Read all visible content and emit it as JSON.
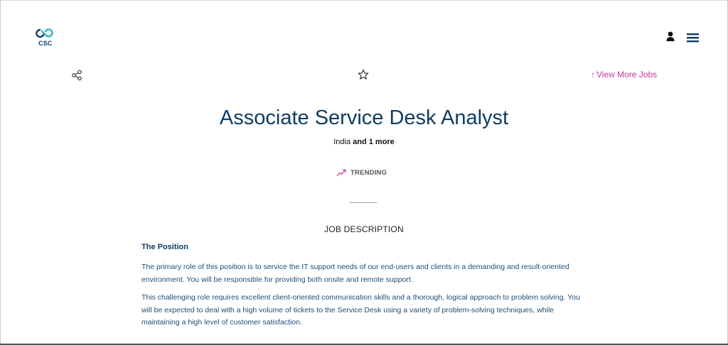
{
  "header": {
    "logo_text": "CSC",
    "user_icon": "user-icon",
    "menu_icon": "hamburger-menu-icon"
  },
  "actions": {
    "share_icon": "share-icon",
    "star_icon": "star-icon",
    "view_more_arrow": "↑",
    "view_more_label": "View More Jobs"
  },
  "job": {
    "title": "Associate Service Desk Analyst",
    "location_primary": "India",
    "location_more": "and 1 more",
    "trending_label": "TRENDING"
  },
  "description": {
    "heading": "JOB DESCRIPTION",
    "position_heading": "The Position",
    "paragraphs": [
      "The primary role of this position is to service the IT support needs of our end-users and clients in a demanding and result-oriented environment. You will be responsible for providing both onsite and remote support.",
      "This challenging role requires excellent client-oriented communication skills and a thorough, logical approach to problem solving. You will be expected to deal with a high volume of tickets to the Service Desk using a variety of problem-solving techniques, while maintaining a high level of customer satisfaction."
    ]
  },
  "colors": {
    "brand_navy": "#0f3d63",
    "accent_pink": "#c6379a",
    "body_text": "#1d4e7a"
  }
}
